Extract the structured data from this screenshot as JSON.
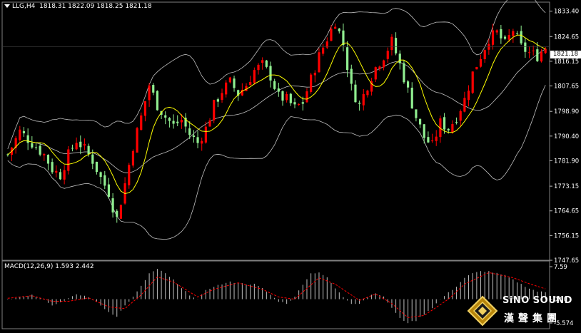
{
  "header": {
    "symbol_label": "LLG,H4",
    "ohlc_label": "1818.31 1822.09 1818.25 1821.18"
  },
  "current_price": "1821.18",
  "macd": {
    "label": "MACD(12,26,9) 1.593 2.442",
    "axis": {
      "top": "7.59",
      "zero": "0.00",
      "bottom": "-5.574"
    }
  },
  "branding": {
    "name_en": "SiNO SOUND",
    "name_zh": "漢聲集團"
  },
  "colors": {
    "background": "#000000",
    "bull": "#ff0000",
    "bear": "#90ee90",
    "ma": "#ffff00",
    "band": "#c0c0c0",
    "signal": "#ff0000",
    "histogram": "#c0c0c0"
  },
  "chart_data": {
    "type": "candlestick",
    "y_ticks": [
      "1833.40",
      "1824.65",
      "1816.15",
      "1807.65",
      "1798.90",
      "1790.40",
      "1781.90",
      "1773.15",
      "1764.65",
      "1756.15",
      "1747.65"
    ],
    "ylim": [
      1747.65,
      1836.5
    ],
    "indicators": [
      "Bollinger Bands",
      "Moving Average",
      "MACD(12,26,9)"
    ],
    "price_path": [
      [
        0,
        1784
      ],
      [
        3,
        1792
      ],
      [
        6,
        1788
      ],
      [
        9,
        1784
      ],
      [
        11,
        1779
      ],
      [
        13,
        1777
      ],
      [
        15,
        1784
      ],
      [
        17,
        1789
      ],
      [
        19,
        1786
      ],
      [
        21,
        1782
      ],
      [
        23,
        1776
      ],
      [
        25,
        1771
      ],
      [
        26,
        1766
      ],
      [
        27,
        1762
      ],
      [
        29,
        1774
      ],
      [
        31,
        1787
      ],
      [
        33,
        1797
      ],
      [
        35,
        1808
      ],
      [
        37,
        1801
      ],
      [
        39,
        1797
      ],
      [
        41,
        1794
      ],
      [
        43,
        1796
      ],
      [
        45,
        1791
      ],
      [
        47,
        1788
      ],
      [
        49,
        1793
      ],
      [
        51,
        1801
      ],
      [
        53,
        1806
      ],
      [
        55,
        1809
      ],
      [
        57,
        1805
      ],
      [
        59,
        1808
      ],
      [
        61,
        1813
      ],
      [
        63,
        1815
      ],
      [
        65,
        1811
      ],
      [
        67,
        1804
      ],
      [
        69,
        1803
      ],
      [
        71,
        1800
      ],
      [
        73,
        1802
      ],
      [
        75,
        1810
      ],
      [
        77,
        1818
      ],
      [
        79,
        1824
      ],
      [
        81,
        1830
      ],
      [
        83,
        1822
      ],
      [
        85,
        1807
      ],
      [
        87,
        1801
      ],
      [
        89,
        1808
      ],
      [
        91,
        1814
      ],
      [
        93,
        1818
      ],
      [
        95,
        1823
      ],
      [
        97,
        1815
      ],
      [
        99,
        1806
      ],
      [
        101,
        1797
      ],
      [
        103,
        1790
      ],
      [
        105,
        1787
      ],
      [
        107,
        1795
      ],
      [
        109,
        1793
      ],
      [
        111,
        1797
      ],
      [
        113,
        1803
      ],
      [
        115,
        1812
      ],
      [
        117,
        1818
      ],
      [
        119,
        1824
      ],
      [
        121,
        1826
      ],
      [
        123,
        1822
      ],
      [
        125,
        1827
      ],
      [
        127,
        1821
      ],
      [
        129,
        1819
      ],
      [
        131,
        1818
      ],
      [
        133,
        1821
      ]
    ],
    "macd_hist_path": [
      [
        0,
        0.0
      ],
      [
        3,
        0.5
      ],
      [
        6,
        1.0
      ],
      [
        9,
        0.0
      ],
      [
        11,
        -1.5
      ],
      [
        13,
        -0.7
      ],
      [
        15,
        0.2
      ],
      [
        17,
        1.0
      ],
      [
        19,
        0.8
      ],
      [
        21,
        0.0
      ],
      [
        23,
        -1.5
      ],
      [
        25,
        -3.0
      ],
      [
        27,
        -4.0
      ],
      [
        29,
        -1.5
      ],
      [
        31,
        0.5
      ],
      [
        33,
        3.0
      ],
      [
        35,
        6.0
      ],
      [
        37,
        7.0
      ],
      [
        39,
        6.0
      ],
      [
        41,
        4.5
      ],
      [
        43,
        2.5
      ],
      [
        45,
        1.0
      ],
      [
        47,
        0.0
      ],
      [
        49,
        2.0
      ],
      [
        51,
        3.0
      ],
      [
        53,
        3.5
      ],
      [
        55,
        4.0
      ],
      [
        57,
        3.8
      ],
      [
        59,
        3.5
      ],
      [
        61,
        3.5
      ],
      [
        63,
        2.5
      ],
      [
        65,
        1.0
      ],
      [
        67,
        -0.5
      ],
      [
        69,
        -1.0
      ],
      [
        71,
        0.5
      ],
      [
        73,
        3.5
      ],
      [
        75,
        6.0
      ],
      [
        77,
        6.3
      ],
      [
        79,
        5.0
      ],
      [
        81,
        2.5
      ],
      [
        83,
        0.5
      ],
      [
        85,
        -1.0
      ],
      [
        87,
        -1.0
      ],
      [
        89,
        0.5
      ],
      [
        91,
        1.5
      ],
      [
        93,
        0.5
      ],
      [
        95,
        -2.0
      ],
      [
        97,
        -4.5
      ],
      [
        99,
        -5.5
      ],
      [
        101,
        -5.0
      ],
      [
        103,
        -3.5
      ],
      [
        105,
        -2.0
      ],
      [
        107,
        0.0
      ],
      [
        109,
        1.5
      ],
      [
        111,
        3.0
      ],
      [
        113,
        5.0
      ],
      [
        115,
        6.0
      ],
      [
        117,
        6.5
      ],
      [
        119,
        6.5
      ],
      [
        121,
        6.0
      ],
      [
        123,
        5.5
      ],
      [
        125,
        4.5
      ],
      [
        127,
        3.5
      ],
      [
        129,
        2.5
      ],
      [
        131,
        1.8
      ],
      [
        133,
        1.6
      ]
    ],
    "macd_signal_path": [
      [
        0,
        0.2
      ],
      [
        6,
        0.8
      ],
      [
        11,
        -0.5
      ],
      [
        15,
        -0.5
      ],
      [
        20,
        0.3
      ],
      [
        25,
        -1.8
      ],
      [
        29,
        -2.2
      ],
      [
        33,
        1.0
      ],
      [
        37,
        5.2
      ],
      [
        41,
        4.0
      ],
      [
        47,
        0.5
      ],
      [
        51,
        2.3
      ],
      [
        57,
        3.8
      ],
      [
        63,
        2.3
      ],
      [
        67,
        0.5
      ],
      [
        71,
        0.0
      ],
      [
        77,
        5.0
      ],
      [
        81,
        3.5
      ],
      [
        87,
        -0.3
      ],
      [
        91,
        1.2
      ],
      [
        95,
        -1.0
      ],
      [
        99,
        -4.3
      ],
      [
        103,
        -3.8
      ],
      [
        109,
        0.0
      ],
      [
        113,
        3.5
      ],
      [
        119,
        6.2
      ],
      [
        125,
        5.0
      ],
      [
        129,
        3.6
      ],
      [
        133,
        2.4
      ]
    ]
  }
}
